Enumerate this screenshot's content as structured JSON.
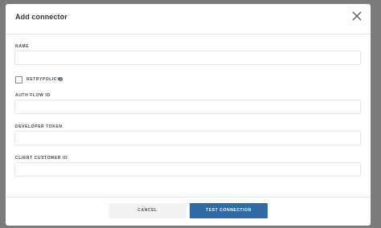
{
  "modal": {
    "title": "Add connector",
    "close_icon": "close-icon"
  },
  "fields": {
    "name": {
      "label": "NAME",
      "value": ""
    },
    "retry_policy": {
      "label": "RETRYPOLICY",
      "checked": false,
      "help_icon": "info-icon"
    },
    "auth_flow_id": {
      "label": "AUTH FLOW ID",
      "value": ""
    },
    "developer_token": {
      "label": "DEVELOPER TOKEN",
      "value": ""
    },
    "client_customer_id": {
      "label": "CLIENT CUSTOMER ID",
      "value": ""
    }
  },
  "footer": {
    "cancel_label": "CANCEL",
    "test_label": "TEST CONNECTION"
  },
  "colors": {
    "backdrop": "#7b7b7b",
    "primary": "#2f6aa8",
    "cancel_bg": "#f2f2f2"
  }
}
